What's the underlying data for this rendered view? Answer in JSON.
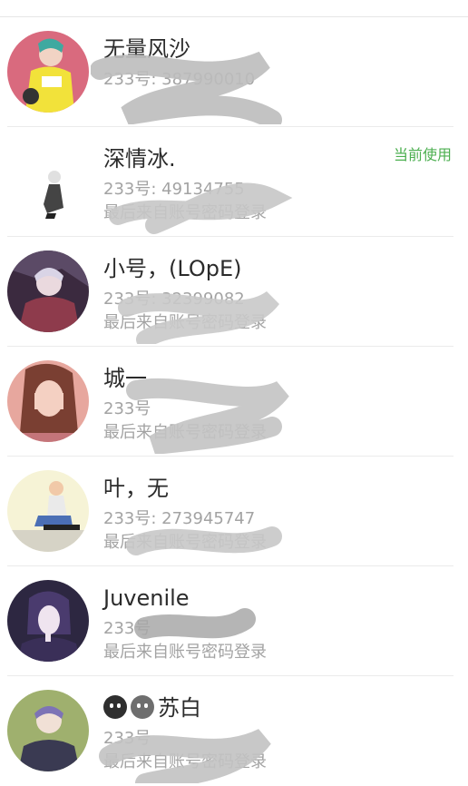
{
  "accounts": [
    {
      "name": "无量风沙",
      "uid": "233号: 387990010",
      "login": "",
      "current": "",
      "avatar_bg": "#d96a7e"
    },
    {
      "name": "深情冰.",
      "uid": "233号: 49134755",
      "login": "最后来自账号密码登录",
      "current": "当前使用",
      "avatar_bg": "#ffffff"
    },
    {
      "name": "小号，(LOpE)",
      "uid": "233号: 32399082",
      "login": "最后来自账号密码登录",
      "current": "",
      "avatar_bg": "#3b2a3f"
    },
    {
      "name": "城一",
      "uid": "233号",
      "login": "最后来自账号密码登录",
      "current": "",
      "avatar_bg": "#e7a79e"
    },
    {
      "name": "叶，无",
      "uid": "233号: 273945747",
      "login": "最后来自账号密码登录",
      "current": "",
      "avatar_bg": "#f6f3d6"
    },
    {
      "name": "Juvenile",
      "uid": "233号",
      "login": "最后来自账号密码登录",
      "current": "",
      "avatar_bg": "#2d2741"
    },
    {
      "name": "苏白",
      "uid": "233号",
      "login": "最后来自账号密码登录",
      "current": "",
      "avatar_bg": "#9fb06e"
    }
  ]
}
